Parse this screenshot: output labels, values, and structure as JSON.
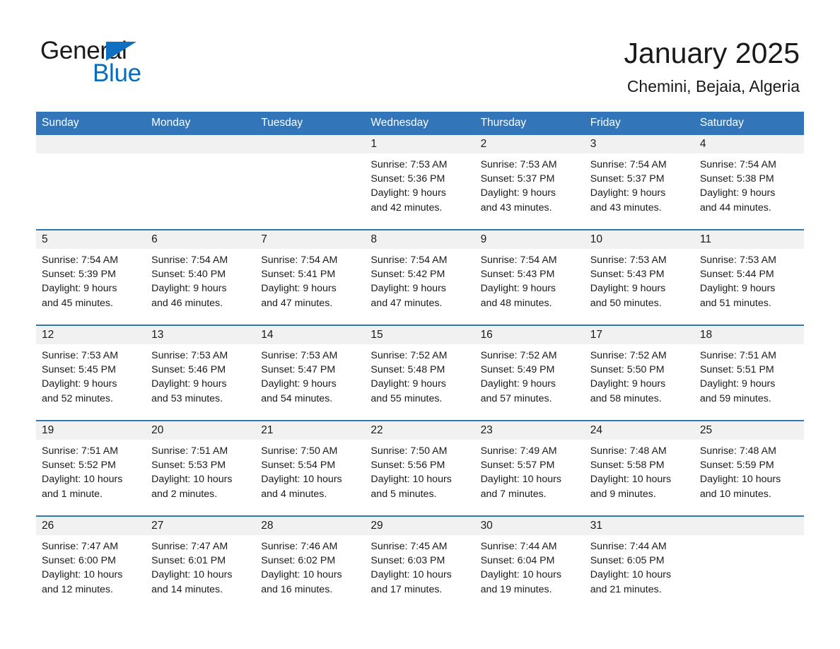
{
  "brand": {
    "name_top": "General",
    "name_bottom": "Blue",
    "accent_color": "#0a6cbd",
    "triangle_color": "#0f6fc0"
  },
  "header": {
    "month_title": "January 2025",
    "location": "Chemini, Bejaia, Algeria",
    "header_bg_color": "#3275b8"
  },
  "weekday_headers": [
    "Sunday",
    "Monday",
    "Tuesday",
    "Wednesday",
    "Thursday",
    "Friday",
    "Saturday"
  ],
  "weeks": [
    [
      {
        "day": "",
        "sunrise": "",
        "sunset": "",
        "daylight_line1": "",
        "daylight_line2": ""
      },
      {
        "day": "",
        "sunrise": "",
        "sunset": "",
        "daylight_line1": "",
        "daylight_line2": ""
      },
      {
        "day": "",
        "sunrise": "",
        "sunset": "",
        "daylight_line1": "",
        "daylight_line2": ""
      },
      {
        "day": "1",
        "sunrise": "Sunrise: 7:53 AM",
        "sunset": "Sunset: 5:36 PM",
        "daylight_line1": "Daylight: 9 hours",
        "daylight_line2": "and 42 minutes."
      },
      {
        "day": "2",
        "sunrise": "Sunrise: 7:53 AM",
        "sunset": "Sunset: 5:37 PM",
        "daylight_line1": "Daylight: 9 hours",
        "daylight_line2": "and 43 minutes."
      },
      {
        "day": "3",
        "sunrise": "Sunrise: 7:54 AM",
        "sunset": "Sunset: 5:37 PM",
        "daylight_line1": "Daylight: 9 hours",
        "daylight_line2": "and 43 minutes."
      },
      {
        "day": "4",
        "sunrise": "Sunrise: 7:54 AM",
        "sunset": "Sunset: 5:38 PM",
        "daylight_line1": "Daylight: 9 hours",
        "daylight_line2": "and 44 minutes."
      }
    ],
    [
      {
        "day": "5",
        "sunrise": "Sunrise: 7:54 AM",
        "sunset": "Sunset: 5:39 PM",
        "daylight_line1": "Daylight: 9 hours",
        "daylight_line2": "and 45 minutes."
      },
      {
        "day": "6",
        "sunrise": "Sunrise: 7:54 AM",
        "sunset": "Sunset: 5:40 PM",
        "daylight_line1": "Daylight: 9 hours",
        "daylight_line2": "and 46 minutes."
      },
      {
        "day": "7",
        "sunrise": "Sunrise: 7:54 AM",
        "sunset": "Sunset: 5:41 PM",
        "daylight_line1": "Daylight: 9 hours",
        "daylight_line2": "and 47 minutes."
      },
      {
        "day": "8",
        "sunrise": "Sunrise: 7:54 AM",
        "sunset": "Sunset: 5:42 PM",
        "daylight_line1": "Daylight: 9 hours",
        "daylight_line2": "and 47 minutes."
      },
      {
        "day": "9",
        "sunrise": "Sunrise: 7:54 AM",
        "sunset": "Sunset: 5:43 PM",
        "daylight_line1": "Daylight: 9 hours",
        "daylight_line2": "and 48 minutes."
      },
      {
        "day": "10",
        "sunrise": "Sunrise: 7:53 AM",
        "sunset": "Sunset: 5:43 PM",
        "daylight_line1": "Daylight: 9 hours",
        "daylight_line2": "and 50 minutes."
      },
      {
        "day": "11",
        "sunrise": "Sunrise: 7:53 AM",
        "sunset": "Sunset: 5:44 PM",
        "daylight_line1": "Daylight: 9 hours",
        "daylight_line2": "and 51 minutes."
      }
    ],
    [
      {
        "day": "12",
        "sunrise": "Sunrise: 7:53 AM",
        "sunset": "Sunset: 5:45 PM",
        "daylight_line1": "Daylight: 9 hours",
        "daylight_line2": "and 52 minutes."
      },
      {
        "day": "13",
        "sunrise": "Sunrise: 7:53 AM",
        "sunset": "Sunset: 5:46 PM",
        "daylight_line1": "Daylight: 9 hours",
        "daylight_line2": "and 53 minutes."
      },
      {
        "day": "14",
        "sunrise": "Sunrise: 7:53 AM",
        "sunset": "Sunset: 5:47 PM",
        "daylight_line1": "Daylight: 9 hours",
        "daylight_line2": "and 54 minutes."
      },
      {
        "day": "15",
        "sunrise": "Sunrise: 7:52 AM",
        "sunset": "Sunset: 5:48 PM",
        "daylight_line1": "Daylight: 9 hours",
        "daylight_line2": "and 55 minutes."
      },
      {
        "day": "16",
        "sunrise": "Sunrise: 7:52 AM",
        "sunset": "Sunset: 5:49 PM",
        "daylight_line1": "Daylight: 9 hours",
        "daylight_line2": "and 57 minutes."
      },
      {
        "day": "17",
        "sunrise": "Sunrise: 7:52 AM",
        "sunset": "Sunset: 5:50 PM",
        "daylight_line1": "Daylight: 9 hours",
        "daylight_line2": "and 58 minutes."
      },
      {
        "day": "18",
        "sunrise": "Sunrise: 7:51 AM",
        "sunset": "Sunset: 5:51 PM",
        "daylight_line1": "Daylight: 9 hours",
        "daylight_line2": "and 59 minutes."
      }
    ],
    [
      {
        "day": "19",
        "sunrise": "Sunrise: 7:51 AM",
        "sunset": "Sunset: 5:52 PM",
        "daylight_line1": "Daylight: 10 hours",
        "daylight_line2": "and 1 minute."
      },
      {
        "day": "20",
        "sunrise": "Sunrise: 7:51 AM",
        "sunset": "Sunset: 5:53 PM",
        "daylight_line1": "Daylight: 10 hours",
        "daylight_line2": "and 2 minutes."
      },
      {
        "day": "21",
        "sunrise": "Sunrise: 7:50 AM",
        "sunset": "Sunset: 5:54 PM",
        "daylight_line1": "Daylight: 10 hours",
        "daylight_line2": "and 4 minutes."
      },
      {
        "day": "22",
        "sunrise": "Sunrise: 7:50 AM",
        "sunset": "Sunset: 5:56 PM",
        "daylight_line1": "Daylight: 10 hours",
        "daylight_line2": "and 5 minutes."
      },
      {
        "day": "23",
        "sunrise": "Sunrise: 7:49 AM",
        "sunset": "Sunset: 5:57 PM",
        "daylight_line1": "Daylight: 10 hours",
        "daylight_line2": "and 7 minutes."
      },
      {
        "day": "24",
        "sunrise": "Sunrise: 7:48 AM",
        "sunset": "Sunset: 5:58 PM",
        "daylight_line1": "Daylight: 10 hours",
        "daylight_line2": "and 9 minutes."
      },
      {
        "day": "25",
        "sunrise": "Sunrise: 7:48 AM",
        "sunset": "Sunset: 5:59 PM",
        "daylight_line1": "Daylight: 10 hours",
        "daylight_line2": "and 10 minutes."
      }
    ],
    [
      {
        "day": "26",
        "sunrise": "Sunrise: 7:47 AM",
        "sunset": "Sunset: 6:00 PM",
        "daylight_line1": "Daylight: 10 hours",
        "daylight_line2": "and 12 minutes."
      },
      {
        "day": "27",
        "sunrise": "Sunrise: 7:47 AM",
        "sunset": "Sunset: 6:01 PM",
        "daylight_line1": "Daylight: 10 hours",
        "daylight_line2": "and 14 minutes."
      },
      {
        "day": "28",
        "sunrise": "Sunrise: 7:46 AM",
        "sunset": "Sunset: 6:02 PM",
        "daylight_line1": "Daylight: 10 hours",
        "daylight_line2": "and 16 minutes."
      },
      {
        "day": "29",
        "sunrise": "Sunrise: 7:45 AM",
        "sunset": "Sunset: 6:03 PM",
        "daylight_line1": "Daylight: 10 hours",
        "daylight_line2": "and 17 minutes."
      },
      {
        "day": "30",
        "sunrise": "Sunrise: 7:44 AM",
        "sunset": "Sunset: 6:04 PM",
        "daylight_line1": "Daylight: 10 hours",
        "daylight_line2": "and 19 minutes."
      },
      {
        "day": "31",
        "sunrise": "Sunrise: 7:44 AM",
        "sunset": "Sunset: 6:05 PM",
        "daylight_line1": "Daylight: 10 hours",
        "daylight_line2": "and 21 minutes."
      },
      {
        "day": "",
        "sunrise": "",
        "sunset": "",
        "daylight_line1": "",
        "daylight_line2": ""
      }
    ]
  ]
}
